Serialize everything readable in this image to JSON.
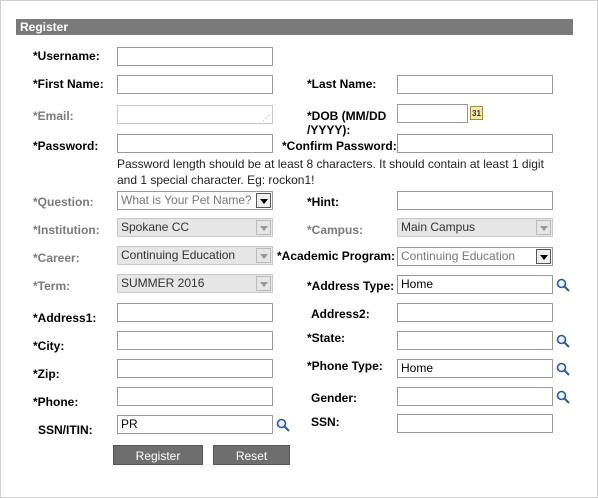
{
  "header": {
    "title": "Register"
  },
  "labels": {
    "username": "*Username:",
    "first_name": "*First Name:",
    "last_name": "*Last Name:",
    "email": "*Email:",
    "dob": "*DOB (MM/DD /YYYY):",
    "password": "*Password:",
    "confirm_password": "*Confirm Password:",
    "question": "*Question:",
    "hint": "*Hint:",
    "institution": "*Institution:",
    "campus": "*Campus:",
    "career": "*Career:",
    "academic_program": "*Academic Program:",
    "term": "*Term:",
    "address_type": "*Address Type:",
    "address1": "*Address1:",
    "address2": "Address2:",
    "city": "*City:",
    "state": "*State:",
    "zip": "*Zip:",
    "phone_type": "*Phone Type:",
    "phone": "*Phone:",
    "gender": "Gender:",
    "ssn_itin": "SSN/ITIN:",
    "ssn": "SSN:"
  },
  "password_hint": "Password length should be at least 8 characters. It should contain at least 1 digit and 1 special character. Eg: rockon1!",
  "values": {
    "question_placeholder": "What is Your Pet Name?",
    "institution": "Spokane CC",
    "campus": "Main Campus",
    "career": "Continuing Education",
    "academic_program": "Continuing Education",
    "term": "SUMMER 2016",
    "address_type": "Home",
    "phone_type": "Home",
    "ssn_itin": "PR"
  },
  "calendar_icon_text": "31",
  "buttons": {
    "register": "Register",
    "reset": "Reset"
  }
}
